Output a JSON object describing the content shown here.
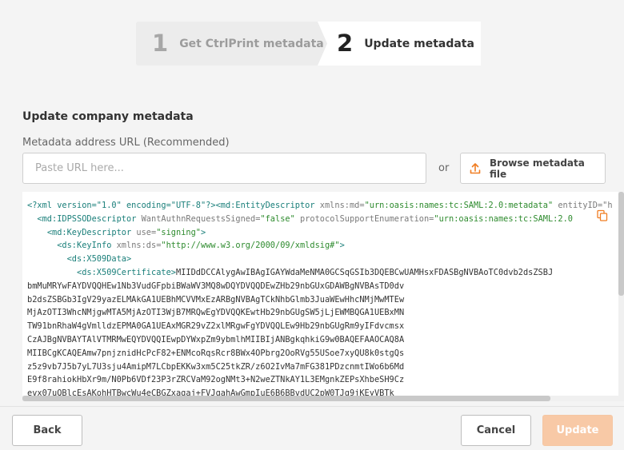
{
  "stepper": {
    "step1": {
      "number": "1",
      "label": "Get CtrlPrint metadata"
    },
    "step2": {
      "number": "2",
      "label": "Update metadata"
    }
  },
  "section": {
    "title": "Update company metadata",
    "field_label": "Metadata address URL (Recommended)",
    "url_placeholder": "Paste URL here...",
    "url_value": "",
    "or": "or",
    "browse_label": "Browse metadata file"
  },
  "xml": {
    "line1": {
      "decl": "<?xml version=\"1.0\" encoding=\"UTF-8\"?>",
      "tag": "<md:EntityDescriptor",
      "attr": " xmlns:md=",
      "value": "\"urn:oasis:names:tc:SAML:2.0:metadata\"",
      "rest": " entityID=\"h"
    },
    "line2": {
      "tag": "<md:IDPSSODescriptor",
      "attr1": " WantAuthnRequestsSigned=",
      "val1": "\"false\"",
      "attr2": " protocolSupportEnumeration=",
      "val2": "\"urn:oasis:names:tc:SAML:2.0"
    },
    "line3": {
      "tag": "<md:KeyDescriptor",
      "attr": " use=",
      "value": "\"signing\"",
      "close": ">"
    },
    "line4": {
      "tag": "<ds:KeyInfo",
      "attr": " xmlns:ds=",
      "value": "\"http://www.w3.org/2000/09/xmldsig#\"",
      "close": ">"
    },
    "line5": {
      "tag": "<ds:X509Data>"
    },
    "line6": {
      "tag": "<ds:X509Certificate>",
      "text": "MIIDdDCCAlygAwIBAgIGAYWdaMeNMA0GCSqGSIb3DQEBCwUAMHsxFDASBgNVBAoTC0dvb2dsZSBJ"
    },
    "cert_lines": [
      "bmMuMRYwFAYDVQQHEw1Nb3VudGFpbiBWaWV3MQ8wDQYDVQQDEwZHb29nbGUxGDAWBgNVBAsTD0dv",
      "b2dsZSBGb3IgV29yazELMAkGA1UEBhMCVVMxEzARBgNVBAgTCkNhbGlmb3JuaWEwHhcNMjMwMTEw",
      "MjAzOTI3WhcNMjgwMTA5MjAzOTI3WjB7MRQwEgYDVQQKEwtHb29nbGUgSW5jLjEWMBQGA1UEBxMN",
      "TW91bnRhaW4gVmlldzEPMA0GA1UEAxMGR29vZ2xlMRgwFgYDVQQLEw9Hb29nbGUgRm9yIFdvcmsx",
      "CzAJBgNVBAYTAlVTMRMwEQYDVQQIEwpDYWxpZm9ybmlhMIIBIjANBgkqhkiG9w0BAQEFAAOCAQ8A",
      "MIIBCgKCAQEAmw7pnjznidHcPcF82+ENMcoRqsRcr8BWx4OPbrg2OoRVg55USoe7xyQU8k0stgQs",
      "z5z9vb7J5b7yL7U3sju4AmipM7LCbpEKKw3xm5C25tkZR/z6O2IvMa7mFG381PDzcnmtIWo6b6Md",
      "E9f8rahiokHbXr9m/N0Pb6VDf23P3rZRCVaM92ogNMt3+N2weZTNkAY1L3EMgnkZEPsXhbeSH9Cz",
      "evx07uQBlcEsAKohHTBwcWu4eCBGZxagaj+FVJgahAwGmpIuE6B6BBvdUC2pW0TJg9jKEyVBTk"
    ]
  },
  "footer": {
    "back": "Back",
    "cancel": "Cancel",
    "update": "Update"
  },
  "colors": {
    "accent": "#f07d22",
    "update_disabled_bg": "#f8c9a6",
    "xml_tag": "#1a7f7a",
    "xml_string": "#2e8b2e"
  },
  "icons": {
    "browse": "upload-icon",
    "copy": "copy-icon"
  }
}
